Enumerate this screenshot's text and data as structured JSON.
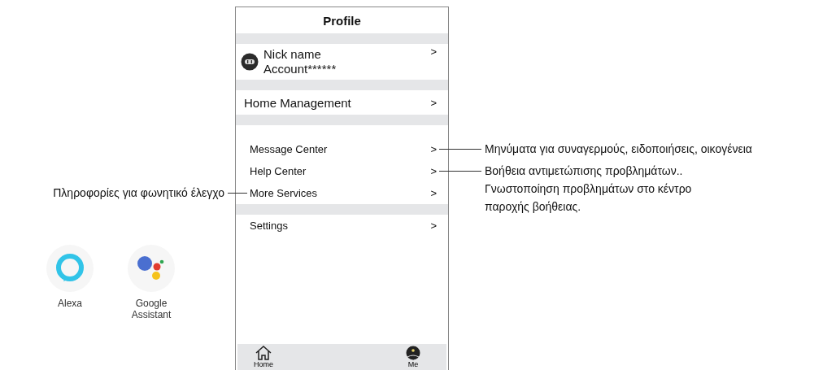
{
  "phone": {
    "title": "Profile",
    "rows": [
      {
        "kind": "gap"
      },
      {
        "kind": "profile",
        "nick": "Nick name",
        "account": "Account******",
        "chevron": ">"
      },
      {
        "kind": "gap"
      },
      {
        "kind": "item",
        "label": "Home Management",
        "chevron": ">"
      },
      {
        "kind": "gap"
      },
      {
        "kind": "spacer"
      },
      {
        "kind": "item",
        "label": "Message Center",
        "chevron": ">",
        "note_right": [
          "Μηνύματα για συναγερμούς, ειδοποιήσεις, οικογένεια"
        ]
      },
      {
        "kind": "item",
        "label": "Help Center",
        "chevron": ">",
        "note_right": [
          "Βοήθεια αντιμετώπισης προβλημάτων..",
          "Γνωστοποίηση προβλημάτων στο κέντρο",
          "παροχής βοήθειας."
        ]
      },
      {
        "kind": "item",
        "label": "More Services",
        "chevron": ">",
        "note_left": "Πληροφορίες για φωνητικό έλεγχο"
      },
      {
        "kind": "gap"
      },
      {
        "kind": "item",
        "label": "Settings",
        "chevron": ">"
      }
    ],
    "tab_bar": [
      {
        "label": "Home",
        "kind": "home"
      },
      {
        "label": "Me",
        "kind": "me"
      }
    ]
  },
  "assistants": [
    {
      "kind": "alexa",
      "label": "Alexa"
    },
    {
      "kind": "google",
      "label": "Google Assistant"
    }
  ]
}
